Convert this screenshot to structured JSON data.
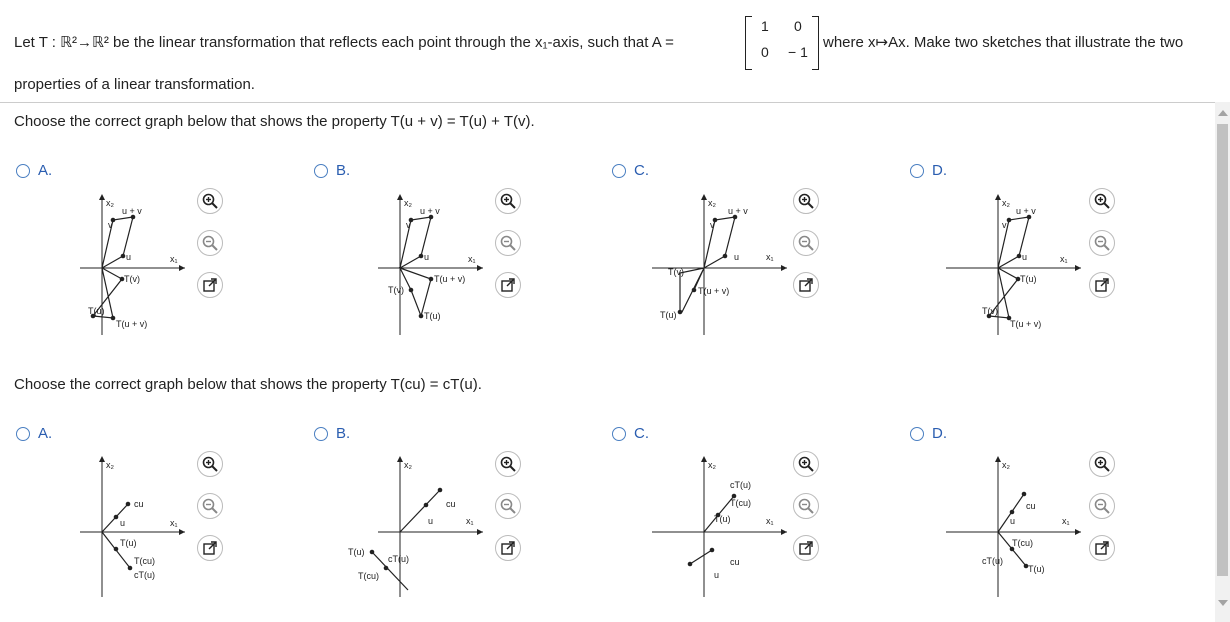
{
  "prompt": {
    "line1_part1": "Let T : ℝ²→ℝ² be the linear transformation that reflects each point through the x₁-axis, such that A =",
    "matrix": [
      "1",
      "0",
      "0",
      "− 1"
    ],
    "line1_part2": "where x↦Ax. Make two sketches that illustrate the two",
    "line2": "properties of a linear transformation."
  },
  "question1": {
    "text": "Choose the correct graph below that shows the property T(u + v) = T(u) + T(v).",
    "options": [
      {
        "letter": "A."
      },
      {
        "letter": "B."
      },
      {
        "letter": "C."
      },
      {
        "letter": "D."
      }
    ]
  },
  "question2": {
    "text": "Choose the correct graph below that shows the property T(cu) = cT(u).",
    "options": [
      {
        "letter": "A."
      },
      {
        "letter": "B."
      },
      {
        "letter": "C."
      },
      {
        "letter": "D."
      }
    ]
  },
  "graph_labels": {
    "x1": "x₁",
    "x2": "x₂",
    "u": "u",
    "v": "v",
    "u_plus_v": "u + v",
    "Tu": "T(u)",
    "Tv": "T(v)",
    "Tuv": "T(u + v)",
    "cu": "cu",
    "Tcu": "T(cu)",
    "cTu": "cT(u)"
  },
  "tool_icons": [
    "zoom-in-icon",
    "zoom-out-icon",
    "open-external-icon"
  ],
  "colors": {
    "accent": "#2a5db0",
    "radio": "#4a7fc1",
    "scroll_thumb": "#c1c1c1"
  }
}
